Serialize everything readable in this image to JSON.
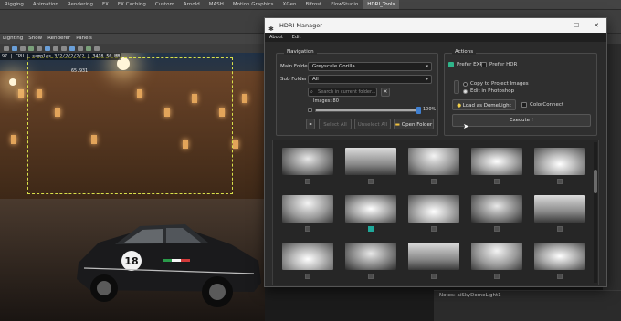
{
  "maya": {
    "shelf_tabs": [
      "Rigging",
      "Animation",
      "Rendering",
      "FX",
      "FX Caching",
      "Custom",
      "Arnold",
      "MASH",
      "Motion Graphics",
      "XGen",
      "Bifrost",
      "FlowStudio",
      "HDRI_Tools"
    ],
    "active_tab": "HDRI_Tools",
    "viewport_menu": [
      "Lighting",
      "Show",
      "Renderer",
      "Panels"
    ],
    "hud_text": "97 | CPU | samples 3/2/2/2/2/2 | 3418.50 MB",
    "hud_value": "65.931",
    "notes_label": "Notes: aiSkyDomeLight1"
  },
  "window": {
    "title": "HDRI Manager",
    "menu": [
      "About",
      "Edit"
    ],
    "controls": [
      "minimize",
      "maximize",
      "close"
    ]
  },
  "navigation": {
    "group_title": "Navigation",
    "main_folder_label": "Main Folder",
    "main_folder_value": "Greyscale Gorilla",
    "sub_folder_label": "Sub Folder",
    "sub_folder_value": "All",
    "search_placeholder": "Search in current folder...",
    "images_label": "Images: 80",
    "images_count": 80,
    "slider_percent_label": "100%",
    "slider_percent": 100,
    "select_all": "Select All",
    "unselect_all": "Unselect All",
    "open_folder": "Open Folder"
  },
  "actions": {
    "group_title": "Actions",
    "prefer_exr": "Prefer EXR",
    "prefer_hdr": "Prefer HDR",
    "copy_label": "Copy to Project Images",
    "edit_label": "Edit in Photoshop",
    "load_label": "Load as DomeLight",
    "colorconnect_label": "ColorConnect",
    "execute_label": "Execute !"
  },
  "colors": {
    "accent_blue": "#3f7fd0",
    "check_green": "#2fb58a",
    "selected_teal": "#1fa89a"
  },
  "thumbnails": {
    "rows": 3,
    "cols": 5,
    "selected_index": 6
  }
}
